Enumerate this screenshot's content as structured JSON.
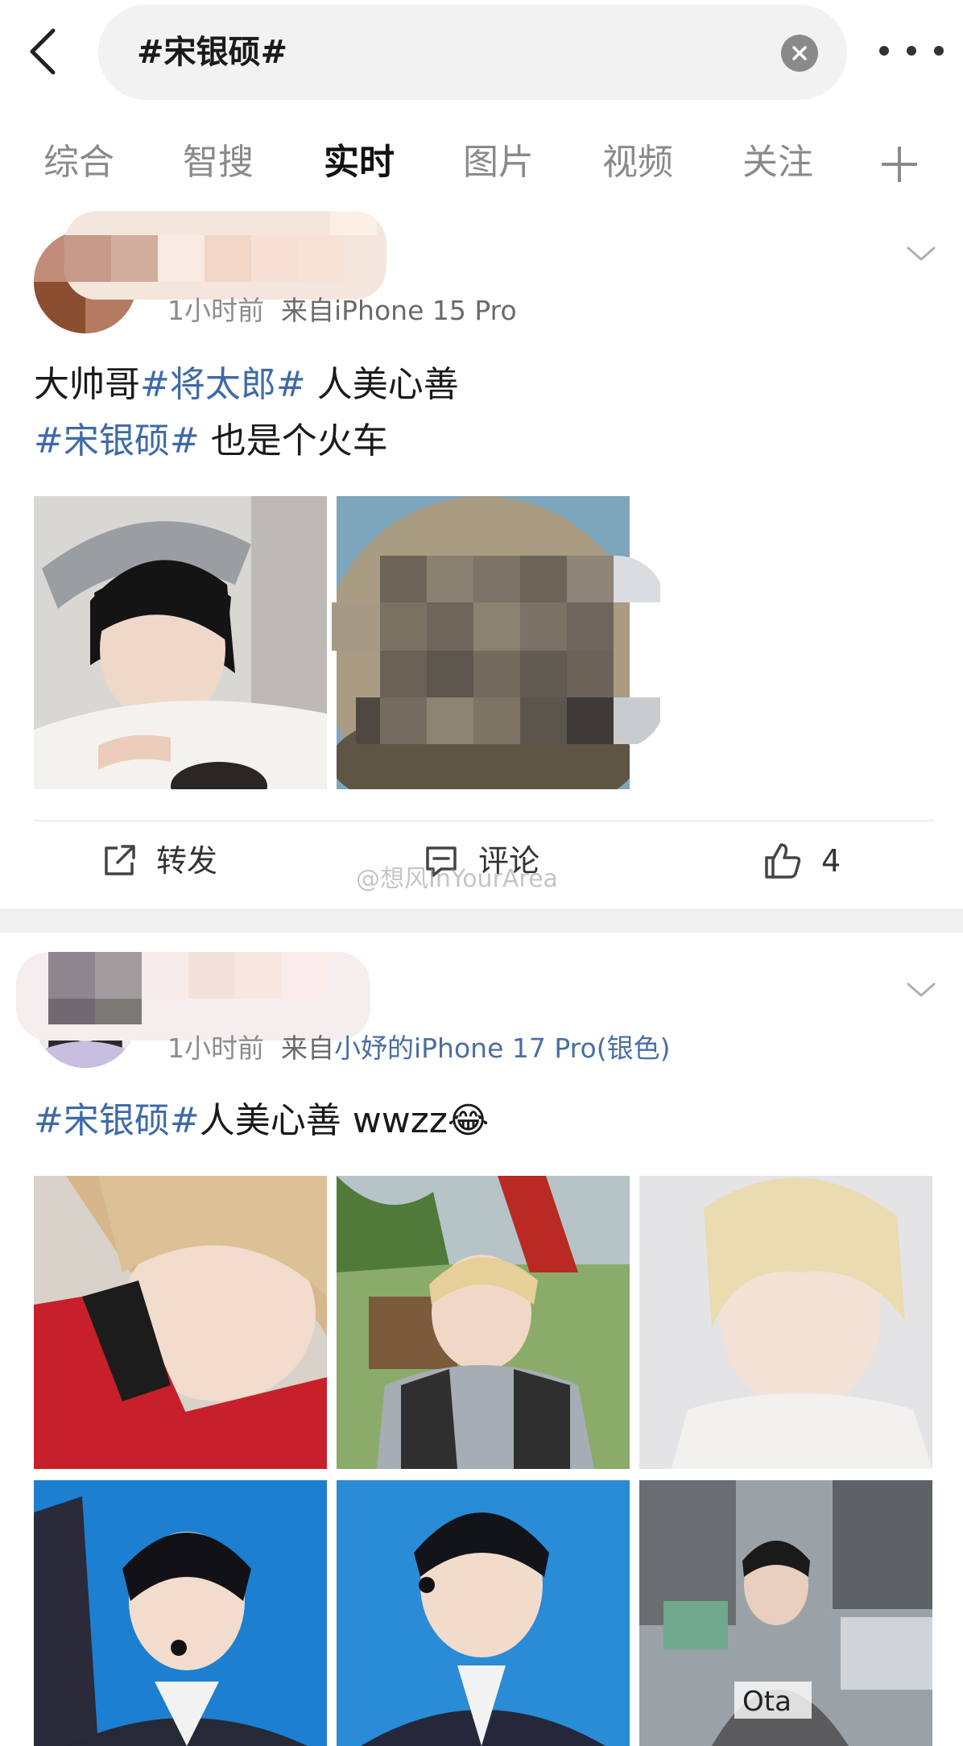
{
  "search": {
    "query": "#宋银硕#"
  },
  "tabs": [
    {
      "label": "综合"
    },
    {
      "label": "智搜"
    },
    {
      "label": "实时"
    },
    {
      "label": "图片"
    },
    {
      "label": "视频"
    },
    {
      "label": "关注"
    }
  ],
  "active_tab": "实时",
  "posts": [
    {
      "time": "1小时前",
      "source_prefix": "来自",
      "source": "iPhone 15 Pro",
      "text_lines": [
        [
          {
            "t": "大帅哥",
            "tag": false
          },
          {
            "t": "#将太郎#",
            "tag": true
          },
          {
            "t": " 人美心善",
            "tag": false
          }
        ],
        [
          {
            "t": "#宋银硕#",
            "tag": true
          },
          {
            "t": " 也是个火车",
            "tag": false
          }
        ]
      ],
      "actions": {
        "repost": "转发",
        "comment": "评论",
        "like_count": "4"
      }
    },
    {
      "time": "1小时前",
      "source_prefix": "来自",
      "source": "小妤的iPhone 17 Pro(银色)",
      "text_lines": [
        [
          {
            "t": "#宋银硕#",
            "tag": true
          },
          {
            "t": "人美心善 wwzz😂",
            "tag": false
          }
        ]
      ]
    }
  ],
  "watermark": "@想风InYourArea",
  "image_overlay_text": "Ota"
}
